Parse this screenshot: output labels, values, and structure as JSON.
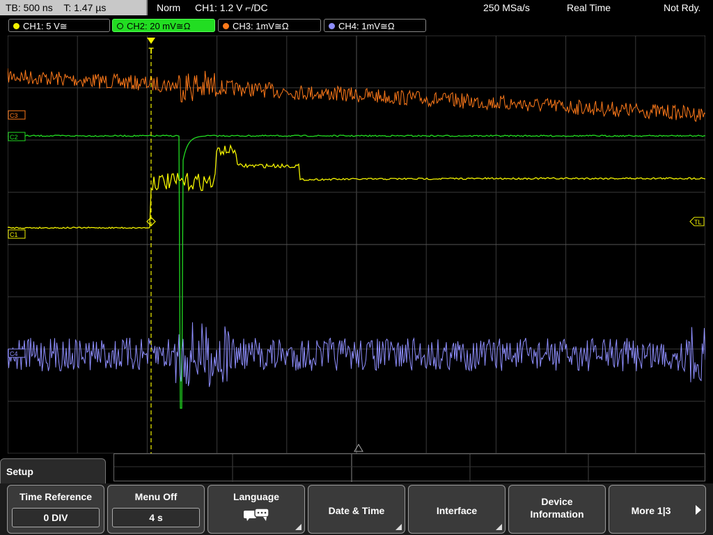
{
  "status_bar": {
    "timebase": "TB: 500 ns",
    "trigger_time": "T: 1.47 µs",
    "mode": "Norm",
    "trigger_info": "CH1: 1.2 V ⌐/DC",
    "sample_rate": "250 MSa/s",
    "acq_mode": "Real Time",
    "state": "Not Rdy."
  },
  "channels": [
    {
      "label": "CH1: 5 V≅",
      "color": "#f2f200",
      "active": false
    },
    {
      "label": "CH2: 20 mV≅Ω",
      "color": "#22dd22",
      "active": true
    },
    {
      "label": "CH3: 1mV≅Ω",
      "color": "#ff7a1a",
      "active": false
    },
    {
      "label": "CH4: 1mV≅Ω",
      "color": "#8f8fff",
      "active": false
    }
  ],
  "markers": {
    "c3": "C3",
    "c2": "C2",
    "c1": "C1",
    "c4": "C4",
    "trigger_level": "TL",
    "trigger_pos": "T"
  },
  "colors": {
    "ch1": "#f2f200",
    "ch2": "#22dd22",
    "ch3": "#ff7a1a",
    "ch4": "#8f8fff",
    "grid": "#3a3a3a"
  },
  "menu": {
    "title": "Setup",
    "keys": [
      {
        "label": "Time Reference",
        "value": "0 DIV"
      },
      {
        "label": "Menu Off",
        "value": "4 s"
      },
      {
        "label": "Language",
        "icon": "speech-bubbles-icon"
      },
      {
        "label": "Date & Time"
      },
      {
        "label": "Interface"
      },
      {
        "label": "Device Information"
      },
      {
        "label": "More 1|3"
      }
    ]
  }
}
